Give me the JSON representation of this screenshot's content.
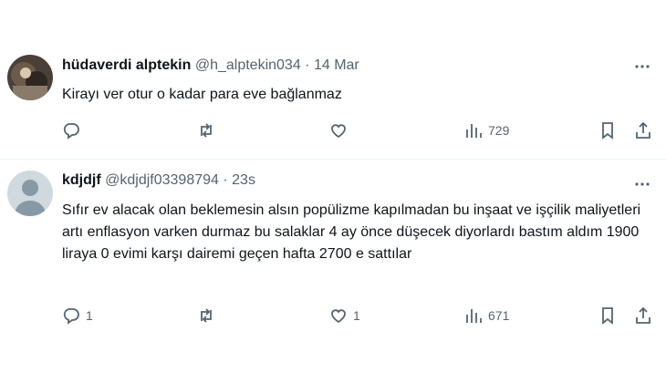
{
  "tweets": [
    {
      "name": "hüdaverdi alptekin",
      "handle": "@h_alptekin034",
      "separator": "·",
      "time": "14 Mar",
      "text": "Kirayı ver otur o kadar para eve bağlanmaz",
      "replies": "",
      "retweets": "",
      "likes": "",
      "views": "729"
    },
    {
      "name": "kdjdjf",
      "handle": "@kdjdjf03398794",
      "separator": "·",
      "time": "23s",
      "text": "Sıfır ev alacak olan beklemesin alsın popülizme kapılmadan bu inşaat ve işçilik maliyetleri artı enflasyon varken durmaz bu salaklar 4 ay önce düşecek diyorlardı bastım aldım 1900 liraya 0 evimi karşı dairemi geçen hafta 2700 e sattılar",
      "replies": "1",
      "retweets": "",
      "likes": "1",
      "views": "671"
    }
  ],
  "icons": {
    "more": "more-horizontal-icon",
    "reply": "reply-bubble-icon",
    "retweet": "retweet-icon",
    "like": "heart-icon",
    "views": "views-bar-chart-icon",
    "bookmark": "bookmark-icon",
    "share": "share-icon"
  },
  "colors": {
    "text": "#0f1419",
    "secondary": "#536471",
    "divider": "#eff3f4",
    "default_avatar_bg": "#cfd9de"
  }
}
